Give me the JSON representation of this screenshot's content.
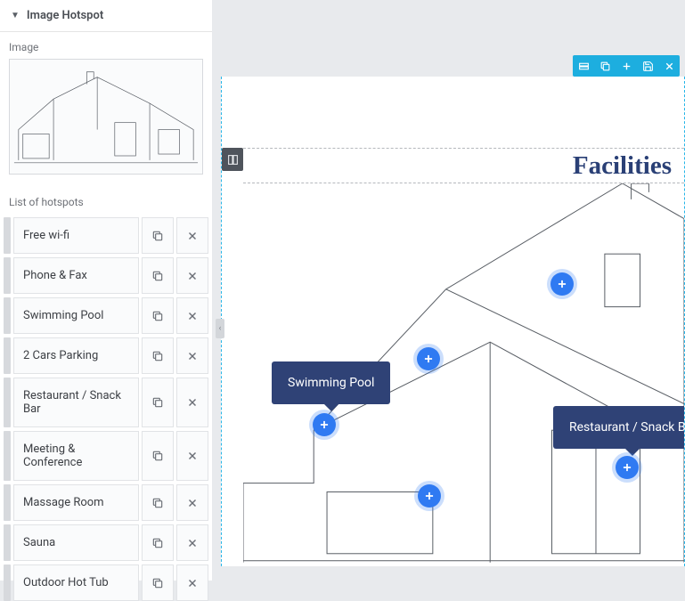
{
  "panel": {
    "title": "Image Hotspot",
    "image_label": "Image",
    "list_label": "List of hotspots"
  },
  "hotspots": [
    {
      "label": "Free wi-fi"
    },
    {
      "label": "Phone & Fax"
    },
    {
      "label": "Swimming Pool"
    },
    {
      "label": "2 Cars Parking"
    },
    {
      "label": "Restaurant / Snack Bar"
    },
    {
      "label": "Meeting & Conference"
    },
    {
      "label": "Massage Room"
    },
    {
      "label": "Sauna"
    },
    {
      "label": "Outdoor Hot Tub"
    }
  ],
  "canvas": {
    "title": "Facilities",
    "markers": {
      "swimming_pool": {
        "label": "Swimming Pool"
      },
      "restaurant": {
        "label": "Restaurant / Snack Bar"
      }
    }
  }
}
